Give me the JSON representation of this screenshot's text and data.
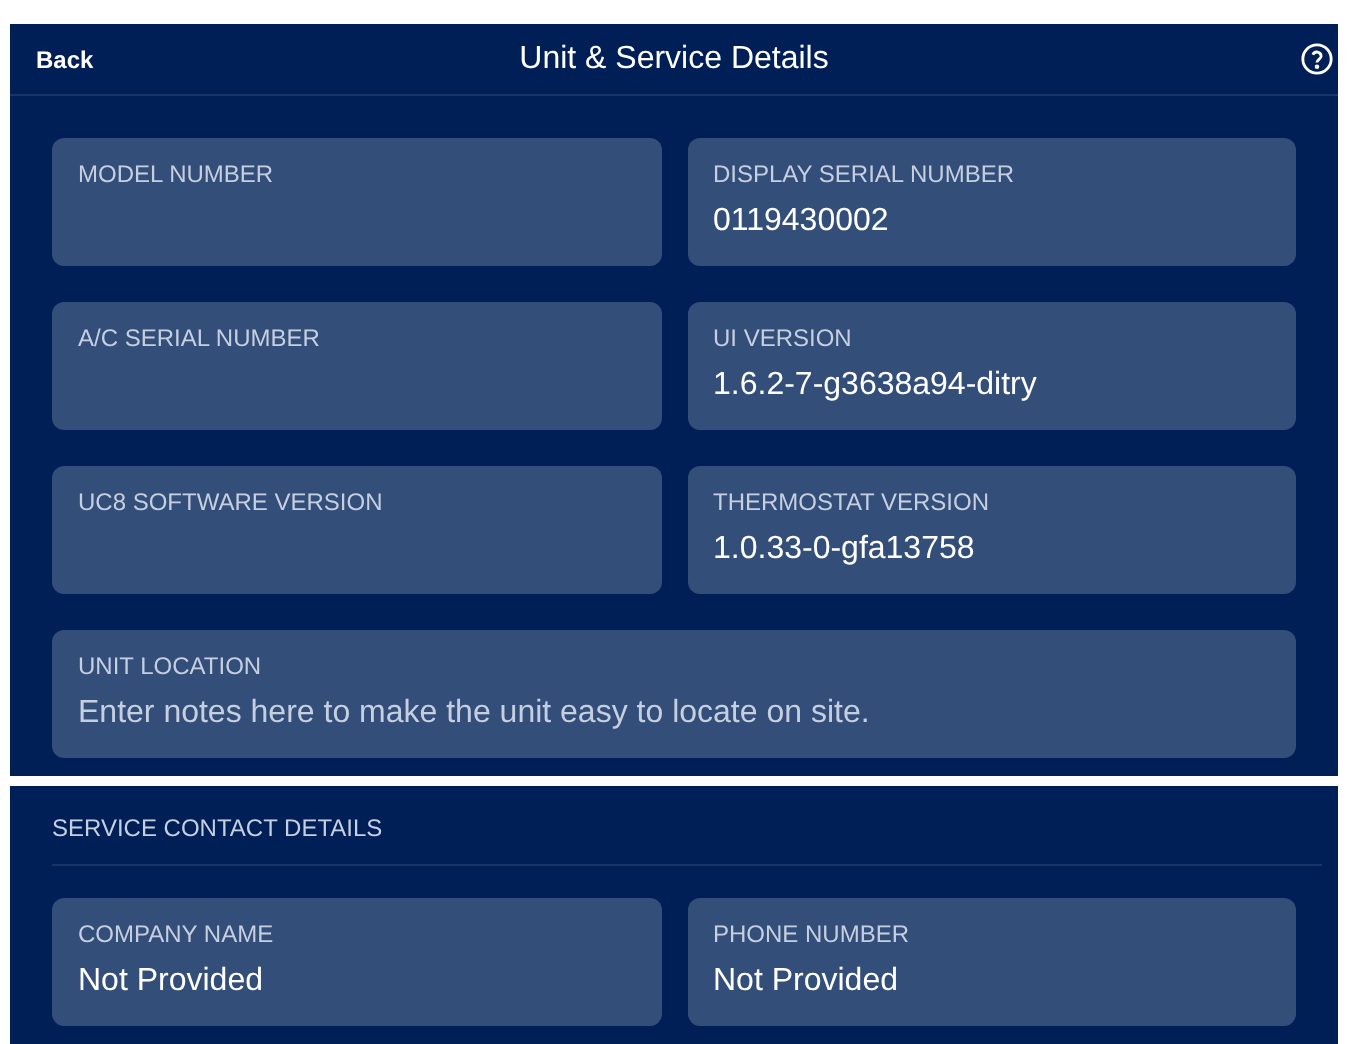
{
  "header": {
    "back": "Back",
    "title": "Unit & Service Details"
  },
  "unit_fields": [
    {
      "label": "MODEL NUMBER"
    },
    {
      "label": "DISPLAY SERIAL NUMBER",
      "value": "0119430002"
    },
    {
      "label": "A/C SERIAL NUMBER"
    },
    {
      "label": "UI VERSION",
      "value": "1.6.2-7-g3638a94-ditry"
    },
    {
      "label": "UC8 SOFTWARE VERSION"
    },
    {
      "label": "THERMOSTAT VERSION",
      "value": "1.0.33-0-gfa13758"
    }
  ],
  "unit_location": {
    "label": "UNIT LOCATION",
    "placeholder": "Enter notes here to make the unit easy to locate on site."
  },
  "service_contact": {
    "title": "SERVICE CONTACT DETAILS",
    "fields": [
      {
        "label": "COMPANY NAME",
        "value": "Not Provided"
      },
      {
        "label": "PHONE NUMBER",
        "value": "Not Provided"
      }
    ]
  }
}
